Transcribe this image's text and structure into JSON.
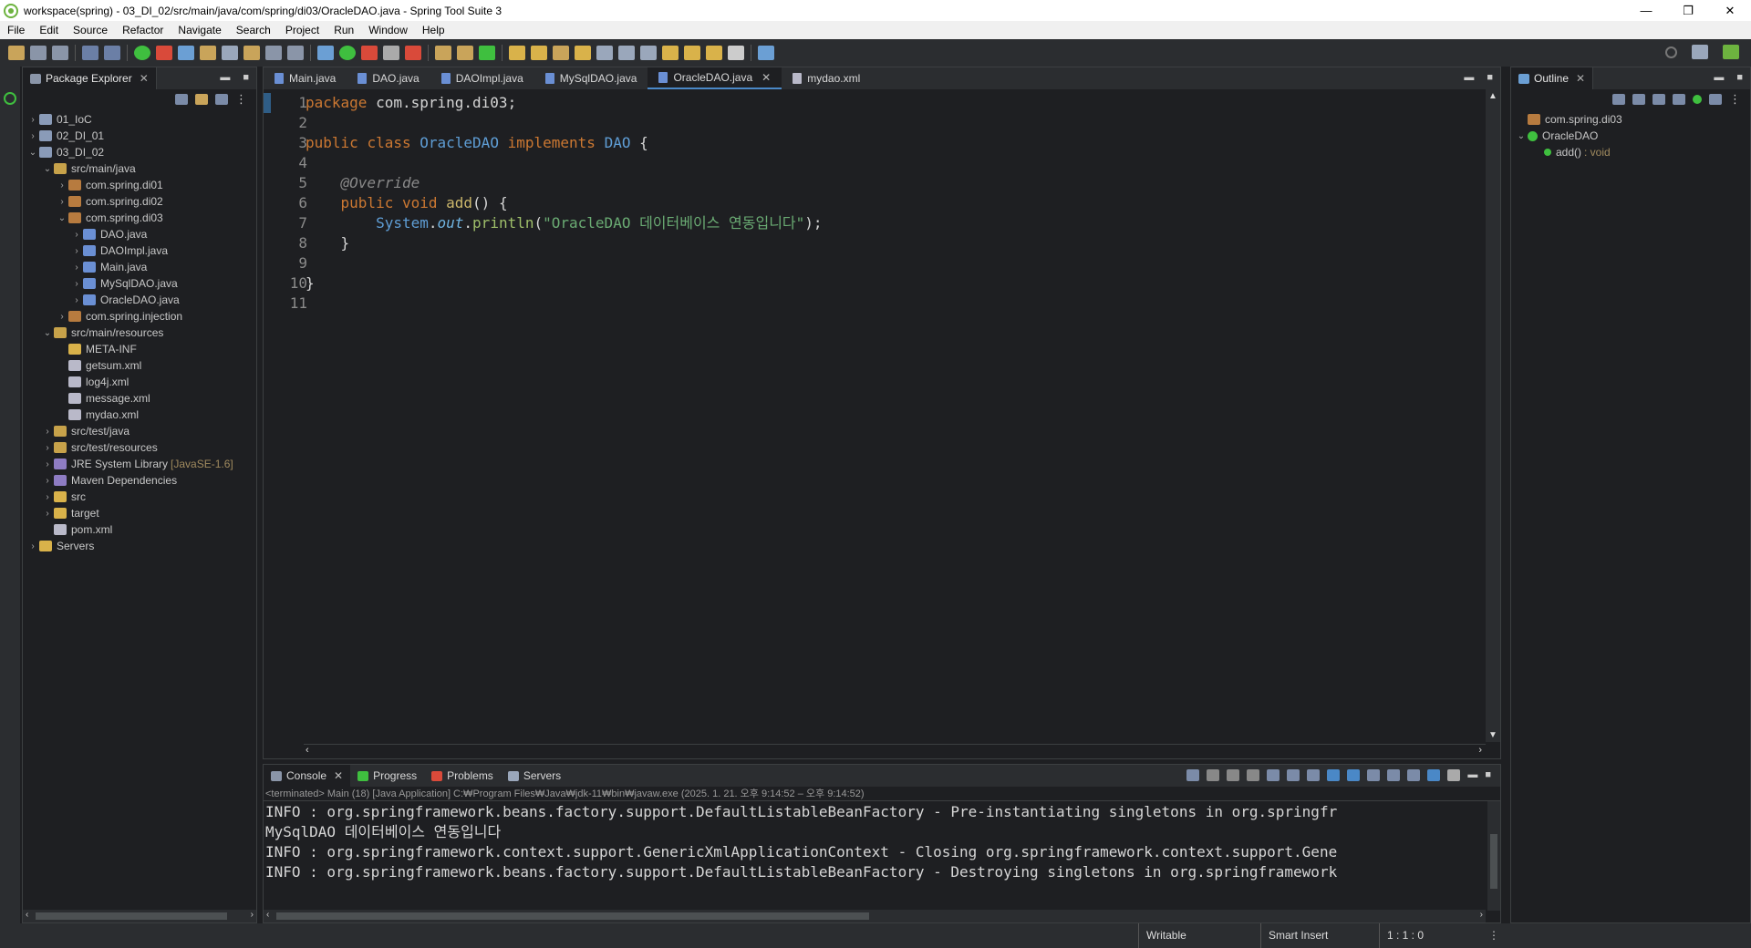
{
  "window": {
    "title": "workspace(spring) - 03_DI_02/src/main/java/com/spring/di03/OracleDAO.java - Spring Tool Suite 3",
    "controls": {
      "minimize": "—",
      "restore": "❐",
      "close": "✕"
    }
  },
  "menu": [
    "File",
    "Edit",
    "Source",
    "Refactor",
    "Navigate",
    "Search",
    "Project",
    "Run",
    "Window",
    "Help"
  ],
  "package_explorer": {
    "title": "Package Explorer",
    "tree": [
      {
        "label": "01_IoC",
        "level": 0,
        "toggle": "›",
        "icon": "proj"
      },
      {
        "label": "02_DI_01",
        "level": 0,
        "toggle": "›",
        "icon": "proj"
      },
      {
        "label": "03_DI_02",
        "level": 0,
        "toggle": "⌄",
        "icon": "proj"
      },
      {
        "label": "src/main/java",
        "level": 1,
        "toggle": "⌄",
        "icon": "src"
      },
      {
        "label": "com.spring.di01",
        "level": 2,
        "toggle": "›",
        "icon": "pkg"
      },
      {
        "label": "com.spring.di02",
        "level": 2,
        "toggle": "›",
        "icon": "pkg"
      },
      {
        "label": "com.spring.di03",
        "level": 2,
        "toggle": "⌄",
        "icon": "pkg"
      },
      {
        "label": "DAO.java",
        "level": 3,
        "toggle": "›",
        "icon": "java"
      },
      {
        "label": "DAOImpl.java",
        "level": 3,
        "toggle": "›",
        "icon": "java"
      },
      {
        "label": "Main.java",
        "level": 3,
        "toggle": "›",
        "icon": "java"
      },
      {
        "label": "MySqlDAO.java",
        "level": 3,
        "toggle": "›",
        "icon": "java"
      },
      {
        "label": "OracleDAO.java",
        "level": 3,
        "toggle": "›",
        "icon": "java"
      },
      {
        "label": "com.spring.injection",
        "level": 2,
        "toggle": "›",
        "icon": "pkg"
      },
      {
        "label": "src/main/resources",
        "level": 1,
        "toggle": "⌄",
        "icon": "src"
      },
      {
        "label": "META-INF",
        "level": 2,
        "toggle": "",
        "icon": "folder"
      },
      {
        "label": "getsum.xml",
        "level": 2,
        "toggle": "",
        "icon": "xml"
      },
      {
        "label": "log4j.xml",
        "level": 2,
        "toggle": "",
        "icon": "xml"
      },
      {
        "label": "message.xml",
        "level": 2,
        "toggle": "",
        "icon": "xml"
      },
      {
        "label": "mydao.xml",
        "level": 2,
        "toggle": "",
        "icon": "xml"
      },
      {
        "label": "src/test/java",
        "level": 1,
        "toggle": "›",
        "icon": "src"
      },
      {
        "label": "src/test/resources",
        "level": 1,
        "toggle": "›",
        "icon": "src"
      },
      {
        "label": "JRE System Library",
        "level": 1,
        "toggle": "›",
        "icon": "lib",
        "deco": "[JavaSE-1.6]"
      },
      {
        "label": "Maven Dependencies",
        "level": 1,
        "toggle": "›",
        "icon": "lib"
      },
      {
        "label": "src",
        "level": 1,
        "toggle": "›",
        "icon": "folder"
      },
      {
        "label": "target",
        "level": 1,
        "toggle": "›",
        "icon": "folder"
      },
      {
        "label": "pom.xml",
        "level": 1,
        "toggle": "",
        "icon": "xml"
      },
      {
        "label": "Servers",
        "level": 0,
        "toggle": "›",
        "icon": "folder"
      }
    ]
  },
  "editor": {
    "tabs": [
      {
        "label": "Main.java",
        "kind": "java",
        "active": false
      },
      {
        "label": "DAO.java",
        "kind": "java",
        "active": false
      },
      {
        "label": "DAOImpl.java",
        "kind": "java",
        "active": false
      },
      {
        "label": "MySqlDAO.java",
        "kind": "java",
        "active": false
      },
      {
        "label": "OracleDAO.java",
        "kind": "java",
        "active": true
      },
      {
        "label": "mydao.xml",
        "kind": "xml",
        "active": false
      }
    ],
    "close_glyph": "✕",
    "line_numbers": [
      "1",
      "2",
      "3",
      "4",
      "5",
      "6",
      "7",
      "8",
      "9",
      "10",
      "11"
    ],
    "code": {
      "l1_kw": "package",
      "l1_rest": " com.spring.di03;",
      "l3_kw1": "public",
      "l3_kw2": "class",
      "l3_name": "OracleDAO",
      "l3_kw3": "implements",
      "l3_iface": "DAO",
      "l3_brace": " {",
      "l5_ann": "@Override",
      "l6_kw1": "public",
      "l6_kw2": "void",
      "l6_fn": "add",
      "l6_rest": "() {",
      "l7_sys": "System",
      "l7_dot1": ".",
      "l7_out": "out",
      "l7_dot2": ".",
      "l7_mth": "println",
      "l7_paren1": "(",
      "l7_str": "\"OracleDAO 데이터베이스 연동입니다\"",
      "l7_paren2": ");",
      "l8": "}",
      "l10": "}"
    }
  },
  "outline": {
    "title": "Outline",
    "items": [
      {
        "label": "com.spring.di03",
        "level": 0,
        "toggle": "",
        "icon": "pkg"
      },
      {
        "label": "OracleDAO",
        "level": 0,
        "toggle": "⌄",
        "icon": "class"
      },
      {
        "label": "add()",
        "type": " : void",
        "level": 1,
        "toggle": "",
        "icon": "method"
      }
    ]
  },
  "console": {
    "tabs": [
      {
        "label": "Console",
        "active": true
      },
      {
        "label": "Progress",
        "active": false
      },
      {
        "label": "Problems",
        "active": false
      },
      {
        "label": "Servers",
        "active": false
      }
    ],
    "status": "<terminated> Main (18) [Java Application] C:₩Program Files₩Java₩jdk-11₩bin₩javaw.exe  (2025. 1. 21. 오후 9:14:52 – 오후 9:14:52)",
    "lines": [
      "INFO : org.springframework.beans.factory.support.DefaultListableBeanFactory - Pre-instantiating singletons in org.springfr",
      "MySqlDAO 데이터베이스 연동입니다",
      "INFO : org.springframework.context.support.GenericXmlApplicationContext - Closing org.springframework.context.support.Gene",
      "INFO : org.springframework.beans.factory.support.DefaultListableBeanFactory - Destroying singletons in org.springframework"
    ]
  },
  "statusbar": {
    "writable": "Writable",
    "insert_mode": "Smart Insert",
    "position": "1 : 1 : 0"
  }
}
